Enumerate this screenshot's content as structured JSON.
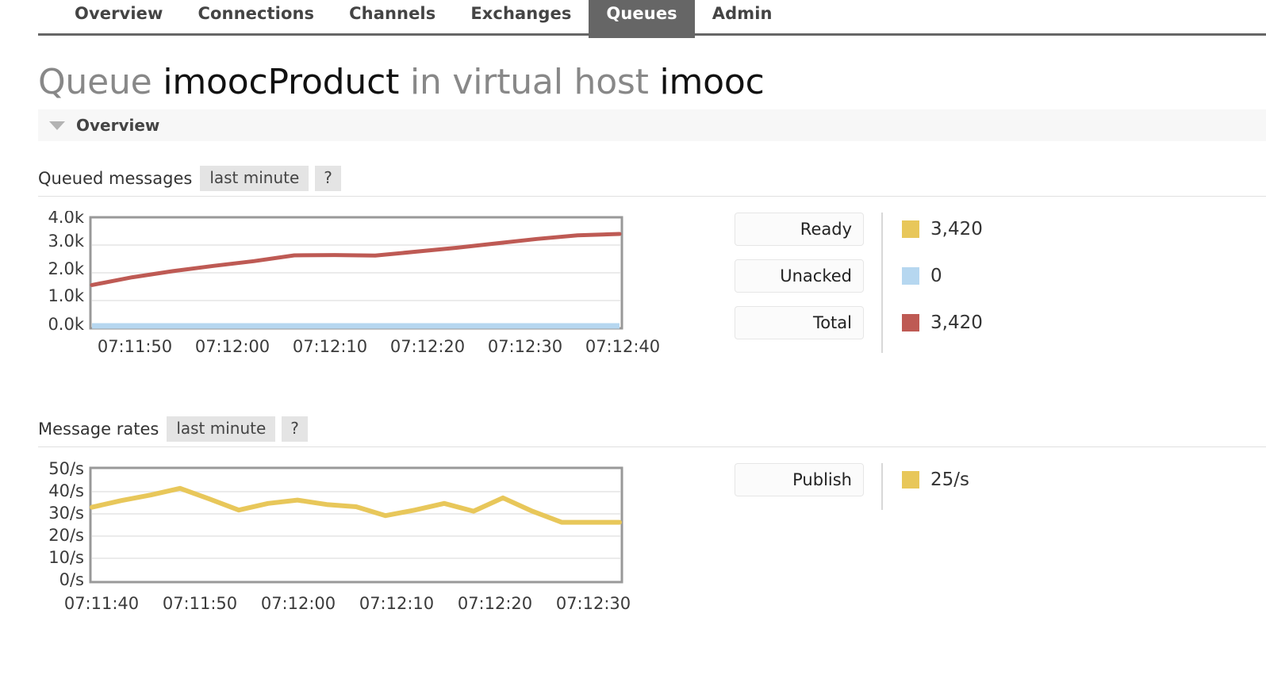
{
  "nav": {
    "tabs": [
      {
        "label": "Overview",
        "active": false
      },
      {
        "label": "Connections",
        "active": false
      },
      {
        "label": "Channels",
        "active": false
      },
      {
        "label": "Exchanges",
        "active": false
      },
      {
        "label": "Queues",
        "active": true
      },
      {
        "label": "Admin",
        "active": false
      }
    ]
  },
  "page": {
    "title_prefix": "Queue",
    "title_queue": "imoocProduct",
    "title_middle": "in virtual host",
    "title_vhost": "imooc"
  },
  "section": {
    "overview_label": "Overview",
    "caret_icon": "caret-down-icon"
  },
  "colors": {
    "ready": "#e8c75a",
    "unacked": "#b6d7f0",
    "total": "#be5a54",
    "publish": "#e8c75a",
    "plot_border": "#999999",
    "gridline": "#ebebeb",
    "active_tab": "#666666"
  },
  "queued_messages": {
    "title": "Queued messages",
    "period": "last minute",
    "help": "?",
    "legend": [
      {
        "label": "Ready",
        "value": "3,420",
        "color": "#e8c75a"
      },
      {
        "label": "Unacked",
        "value": "0",
        "color": "#b6d7f0"
      },
      {
        "label": "Total",
        "value": "3,420",
        "color": "#be5a54"
      }
    ]
  },
  "message_rates": {
    "title": "Message rates",
    "period": "last minute",
    "help": "?",
    "legend": [
      {
        "label": "Publish",
        "value": "25/s",
        "color": "#e8c75a"
      }
    ]
  },
  "chart_data": [
    {
      "type": "line",
      "title": "Queued messages",
      "xlabel": "",
      "ylabel": "",
      "ylim": [
        0,
        4000
      ],
      "yticks": [
        0,
        1000,
        2000,
        3000,
        4000
      ],
      "ytick_labels": [
        "0.0k",
        "1.0k",
        "2.0k",
        "3.0k",
        "4.0k"
      ],
      "xticks": [
        "07:11:50",
        "07:12:00",
        "07:12:10",
        "07:12:20",
        "07:12:30",
        "07:12:40"
      ],
      "grid": true,
      "legend_position": "right",
      "series": [
        {
          "name": "Total",
          "color": "#be5a54",
          "values": [
            1560,
            1840,
            2060,
            2250,
            2420,
            2630,
            2640,
            2620,
            2760,
            2900,
            3060,
            3220,
            3350,
            3400
          ]
        },
        {
          "name": "Unacked",
          "color": "#b6d7f0",
          "values": [
            0,
            0,
            0,
            0,
            0,
            0,
            0,
            0,
            0,
            0,
            0,
            0,
            0,
            0
          ]
        }
      ]
    },
    {
      "type": "line",
      "title": "Message rates",
      "xlabel": "",
      "ylabel": "",
      "ylim": [
        0,
        50
      ],
      "yticks": [
        0,
        10,
        20,
        30,
        40,
        50
      ],
      "ytick_labels": [
        "0/s",
        "10/s",
        "20/s",
        "30/s",
        "40/s",
        "50/s"
      ],
      "xticks": [
        "07:11:40",
        "07:11:50",
        "07:12:00",
        "07:12:10",
        "07:12:20",
        "07:12:30"
      ],
      "grid": true,
      "legend_position": "right",
      "series": [
        {
          "name": "Publish",
          "color": "#e8c75a",
          "values": [
            33,
            36,
            38.5,
            41.5,
            36,
            31,
            34,
            35.5,
            33.5,
            32.5,
            28.5,
            31,
            34,
            30.5,
            36.5,
            30.5,
            25.5,
            25.5,
            25.5
          ]
        }
      ]
    }
  ]
}
